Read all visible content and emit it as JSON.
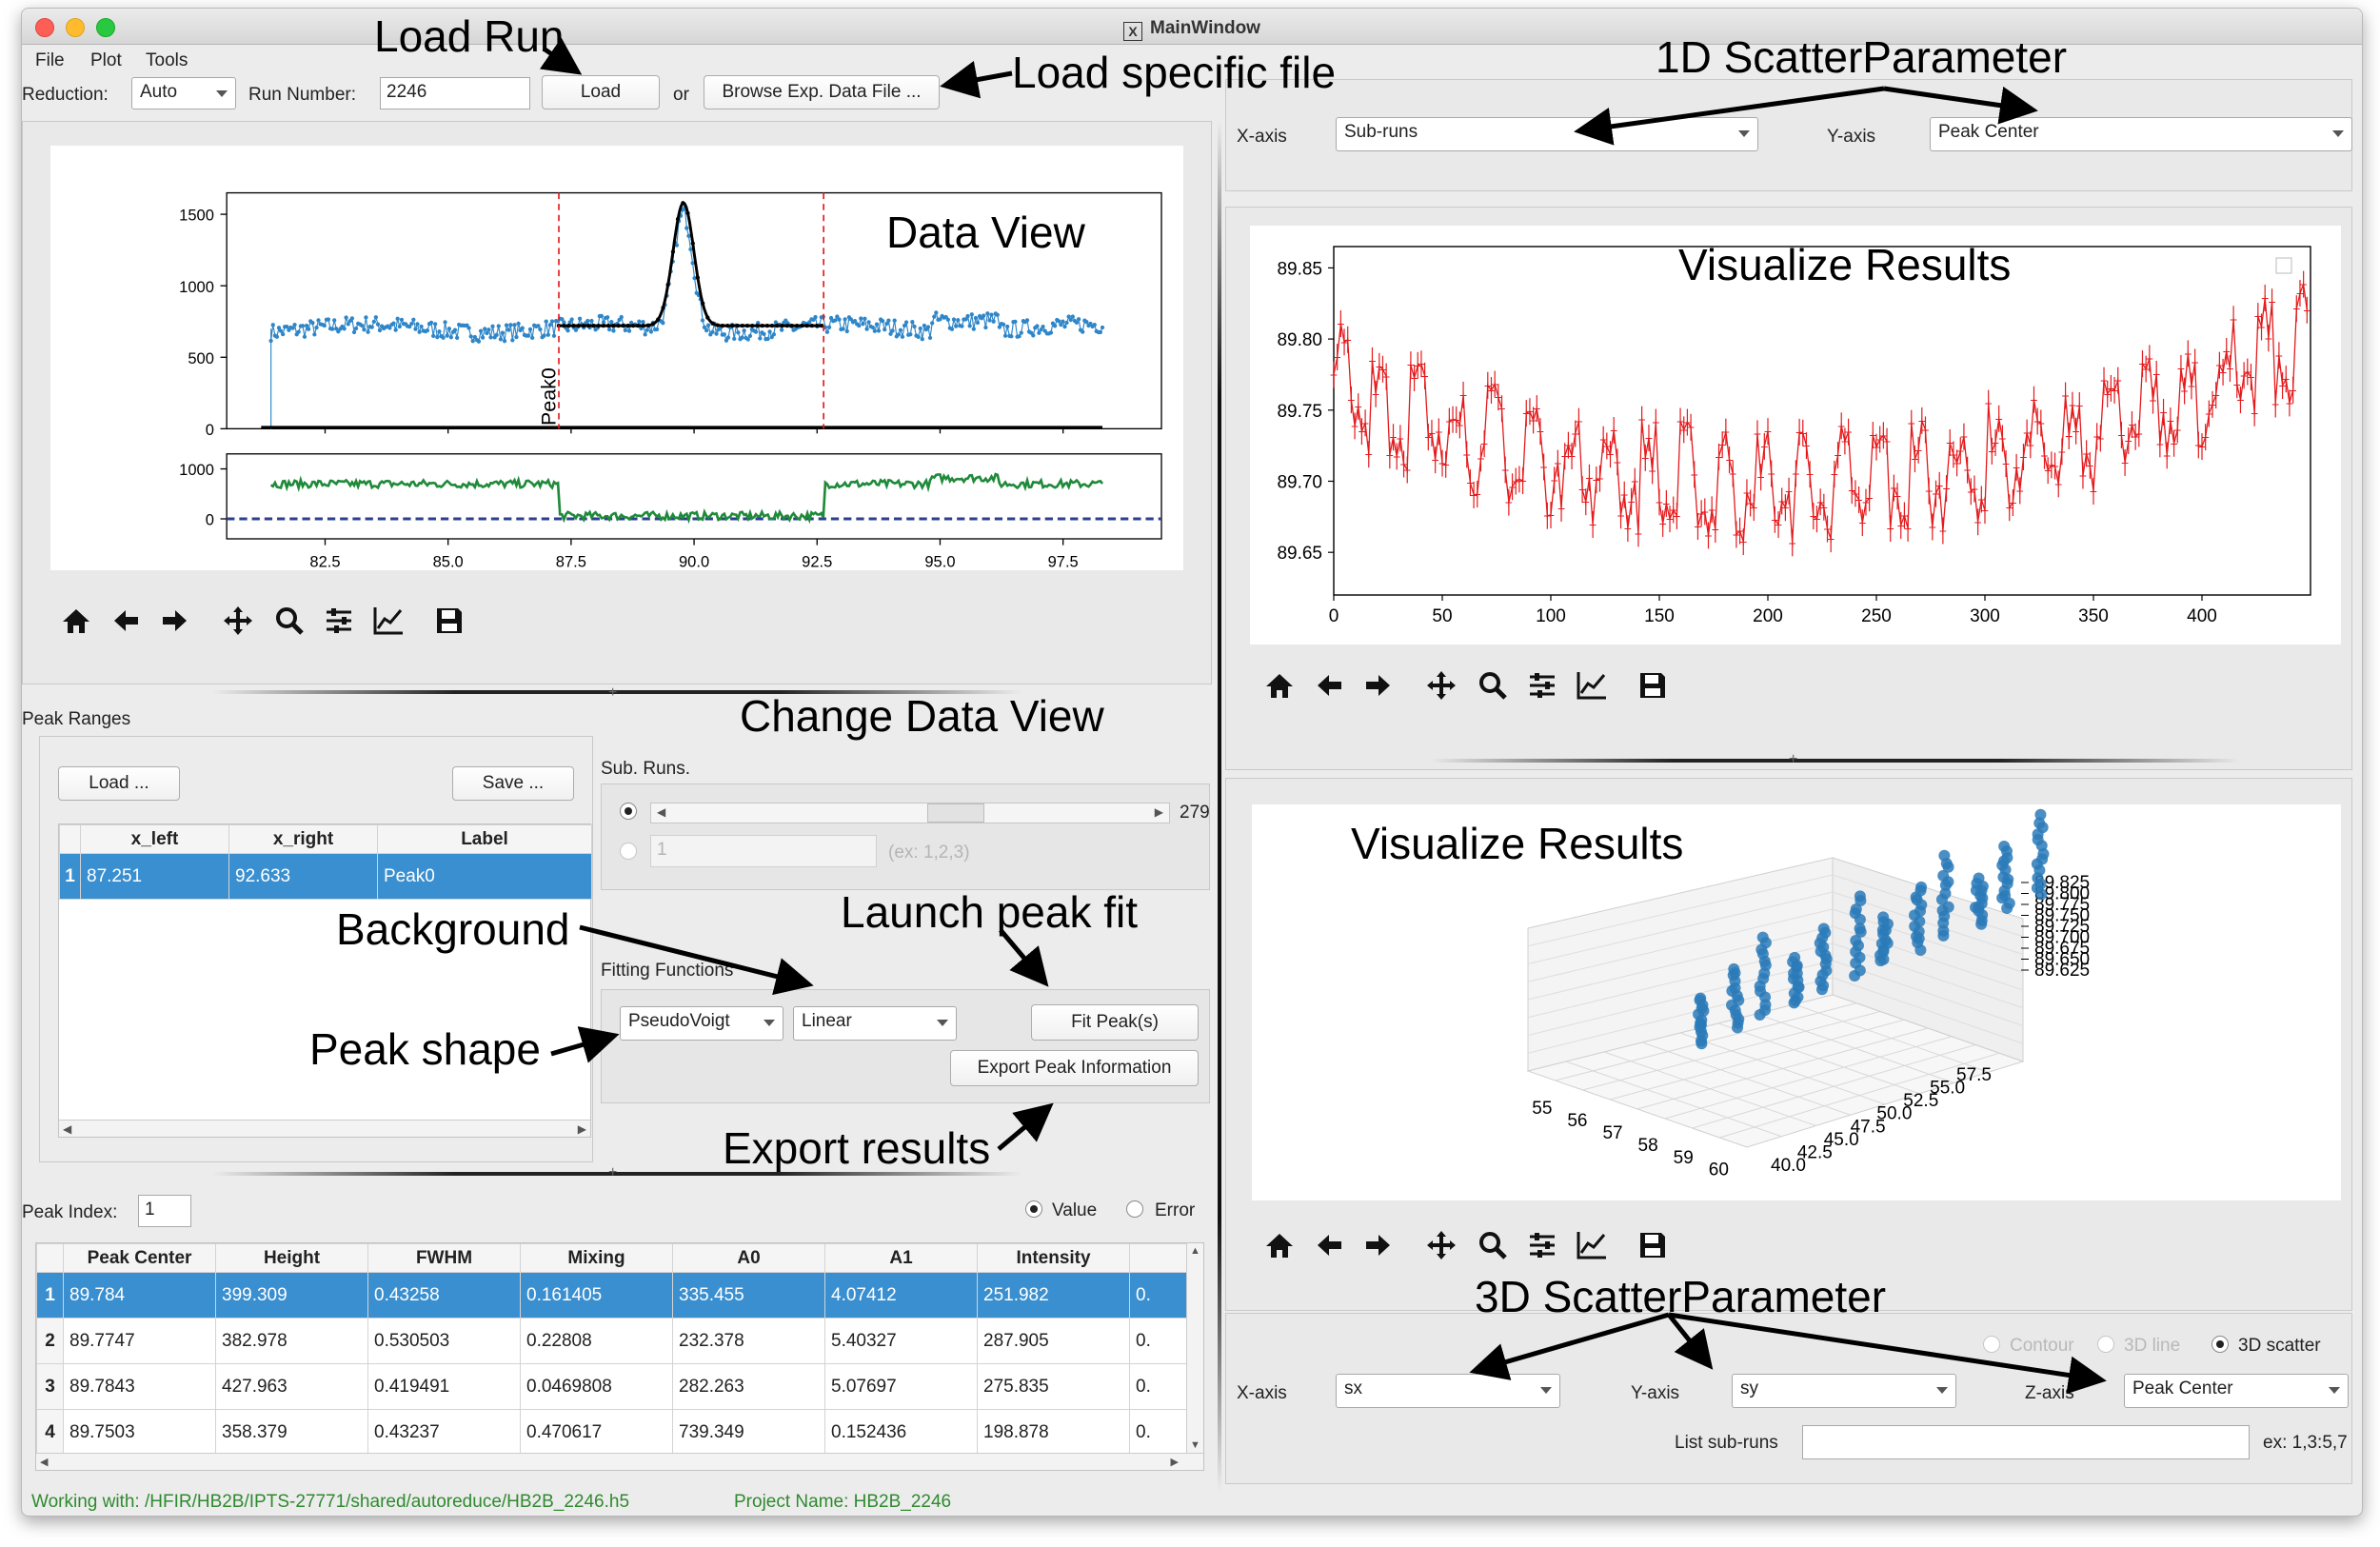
{
  "window": {
    "title": "MainWindow",
    "title_glyph": "X"
  },
  "menu": [
    "File",
    "Plot",
    "Tools"
  ],
  "toolbar": {
    "reduction_label": "Reduction:",
    "reduction_value": "Auto",
    "run_label": "Run Number:",
    "run_value": "2246",
    "load_btn": "Load",
    "or_label": "or",
    "browse_btn": "Browse Exp. Data File ..."
  },
  "annotations": {
    "load_run": "Load Run",
    "load_file": "Load specific file",
    "scatter1d": "1D ScatterParameter",
    "data_view": "Data View",
    "visualize1": "Visualize Results",
    "visualize2": "Visualize Results",
    "change_view": "Change Data View",
    "launch_fit": "Launch peak fit",
    "background": "Background",
    "peak_shape": "Peak shape",
    "export": "Export results",
    "scatter3d": "3D ScatterParameter"
  },
  "data_view": {
    "peak_label": "Peak0",
    "chart_data": {
      "type": "scatter",
      "x_ticks": [
        "82.5",
        "85.0",
        "87.5",
        "90.0",
        "92.5",
        "95.0",
        "97.5"
      ],
      "top_y_ticks": [
        "1500",
        "1000",
        "500",
        "0"
      ],
      "bottom_y_ticks": [
        "1000",
        "0"
      ],
      "xlim": [
        80.5,
        99.5
      ],
      "top_ylim": [
        0,
        1650
      ],
      "bottom_ylim": [
        -400,
        1300
      ],
      "peak_range": [
        87.251,
        92.633
      ],
      "peak_center": 89.784,
      "series": [
        {
          "color": "#2f86c8"
        },
        {
          "color": "#1f8a3a"
        }
      ]
    }
  },
  "peak_ranges": {
    "title": "Peak Ranges",
    "load_btn": "Load ...",
    "save_btn": "Save ...",
    "headers": [
      "x_left",
      "x_right",
      "Label"
    ],
    "rows": [
      {
        "idx": "1",
        "x_left": "87.251",
        "x_right": "92.633",
        "label": "Peak0"
      }
    ]
  },
  "subruns": {
    "label": "Sub. Runs.",
    "count": "279",
    "input_value": "1",
    "input_hint": "(ex: 1,2,3)"
  },
  "fitting": {
    "label": "Fitting Functions",
    "peak_shape": "PseudoVoigt",
    "background": "Linear",
    "fit_btn": "Fit Peak(s)",
    "export_btn": "Export Peak Information"
  },
  "peak_index": {
    "label": "Peak Index:",
    "value": "1",
    "value_opt": "Value",
    "error_opt": "Error"
  },
  "results_table": {
    "headers": [
      "Peak Center",
      "Height",
      "FWHM",
      "Mixing",
      "A0",
      "A1",
      "Intensity"
    ],
    "rows": [
      {
        "idx": "1",
        "cells": [
          "89.784",
          "399.309",
          "0.43258",
          "0.161405",
          "335.455",
          "4.07412",
          "251.982"
        ],
        "trunc": "0."
      },
      {
        "idx": "2",
        "cells": [
          "89.7747",
          "382.978",
          "0.530503",
          "0.22808",
          "232.378",
          "5.40327",
          "287.905"
        ],
        "trunc": "0."
      },
      {
        "idx": "3",
        "cells": [
          "89.7843",
          "427.963",
          "0.419491",
          "0.0469808",
          "282.263",
          "5.07697",
          "275.835"
        ],
        "trunc": "0."
      },
      {
        "idx": "4",
        "cells": [
          "89.7503",
          "358.379",
          "0.43237",
          "0.470617",
          "739.349",
          "0.152436",
          "198.878"
        ],
        "trunc": "0."
      }
    ]
  },
  "status": {
    "working": "Working with: /HFIR/HB2B/IPTS-27771/shared/autoreduce/HB2B_2246.h5",
    "project": "Project Name: HB2B_2246"
  },
  "scatter1d": {
    "x_label": "X-axis",
    "x_value": "Sub-runs",
    "y_label": "Y-axis",
    "y_value": "Peak Center"
  },
  "plot1d": {
    "chart_data": {
      "type": "scatter",
      "x_ticks": [
        "0",
        "50",
        "100",
        "150",
        "200",
        "250",
        "300",
        "350",
        "400"
      ],
      "y_ticks": [
        "89.85",
        "89.80",
        "89.75",
        "89.70",
        "89.65"
      ],
      "xlim": [
        0,
        450
      ],
      "ylim": [
        89.62,
        89.865
      ],
      "points": 279,
      "series": [
        {
          "color": "#e41a1c"
        }
      ]
    }
  },
  "plot3d": {
    "chart_data": {
      "type": "scatter",
      "x_ticks": [
        "55",
        "56",
        "57",
        "58",
        "59",
        "60"
      ],
      "y_ticks": [
        "40.0",
        "42.5",
        "45.0",
        "47.5",
        "50.0",
        "52.5",
        "55.0",
        "57.5"
      ],
      "z_ticks": [
        "89.825",
        "89.800",
        "89.775",
        "89.750",
        "89.725",
        "89.700",
        "89.675",
        "89.650",
        "89.625"
      ],
      "series": [
        {
          "color": "#2a7ab8"
        }
      ]
    }
  },
  "scatter3d": {
    "contour": "Contour",
    "line3d": "3D line",
    "scatter": "3D scatter",
    "x_label": "X-axis",
    "x_value": "sx",
    "y_label": "Y-axis",
    "y_value": "sy",
    "z_label": "Z-axis",
    "z_value": "Peak Center",
    "list_label": "List sub-runs",
    "list_hint": "ex: 1,3:5,7"
  }
}
